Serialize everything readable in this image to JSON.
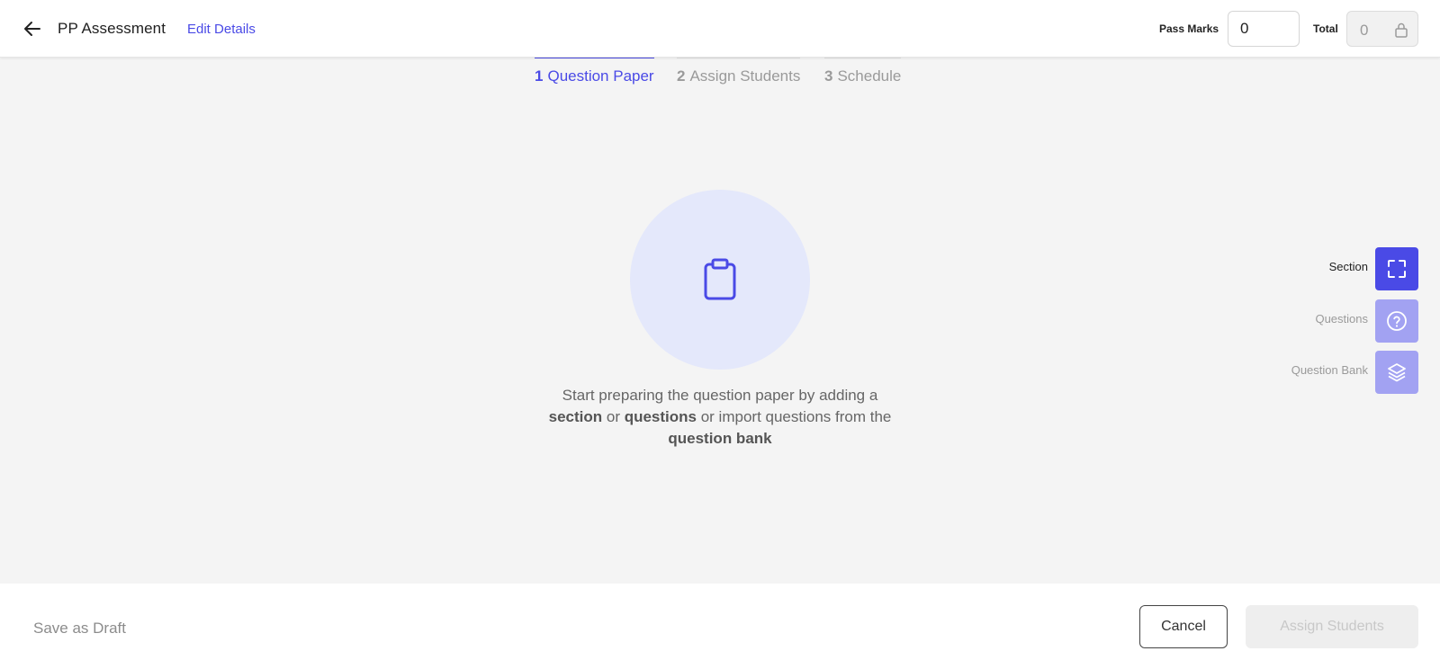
{
  "header": {
    "title": "PP Assessment",
    "edit_link": "Edit Details",
    "pass_marks_label": "Pass Marks",
    "pass_marks_value": "0",
    "total_label": "Total",
    "total_value": "0"
  },
  "steps": [
    {
      "number": "1",
      "label": "Question Paper",
      "active": true
    },
    {
      "number": "2",
      "label": "Assign Students",
      "active": false
    },
    {
      "number": "3",
      "label": "Schedule",
      "active": false
    }
  ],
  "empty_state": {
    "text_part1": "Start preparing the question paper by adding a",
    "bold1": "section",
    "text_part2": " or ",
    "bold2": "questions",
    "text_part3": " or import questions from the",
    "bold3": "question bank"
  },
  "side_actions": {
    "section_label": "Section",
    "questions_label": "Questions",
    "question_bank_label": "Question Bank"
  },
  "footer": {
    "save_draft": "Save as Draft",
    "cancel": "Cancel",
    "assign_students": "Assign Students"
  },
  "colors": {
    "accent": "#4a4ae6",
    "accent_light": "#a2a2f2",
    "empty_circle": "#e4e8fb",
    "background": "#f4f4f4"
  },
  "icons": {
    "back": "arrow-left-icon",
    "lock": "lock-icon",
    "clipboard": "clipboard-icon",
    "section": "expand-frame-icon",
    "questions": "question-circle-icon",
    "question_bank": "layers-icon"
  }
}
